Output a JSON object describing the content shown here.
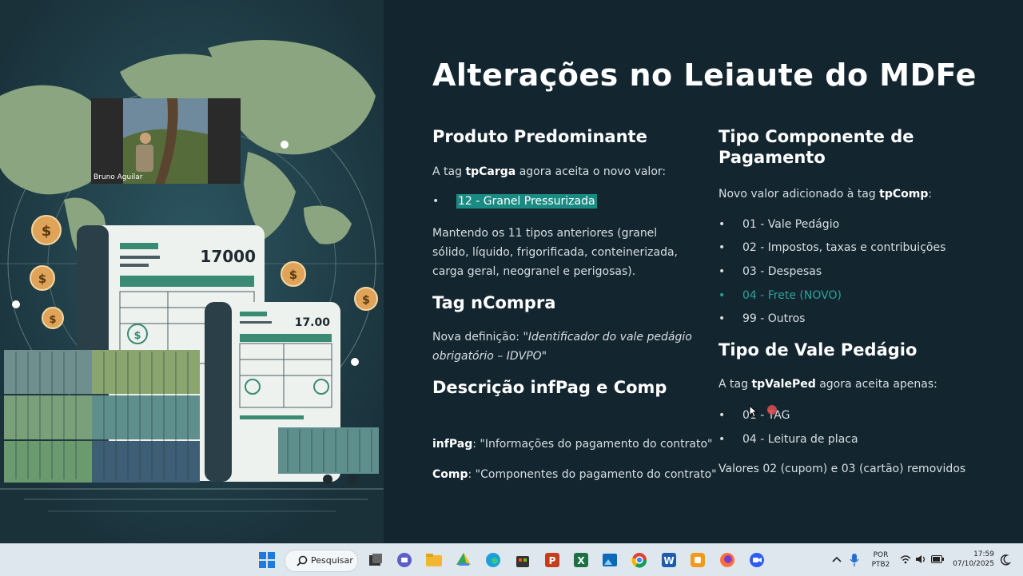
{
  "slide": {
    "title": "Alterações no Leiaute do MDFe",
    "webcam_name": "Bruno Aguilar",
    "left": {
      "s1_heading": "Produto Predominante",
      "s1_text_pre": "A tag ",
      "s1_text_tag": "tpCarga",
      "s1_text_post": " agora aceita o novo valor:",
      "s1_bullet": "12 - Granel Pressurizada",
      "s1_para": "Mantendo os 11 tipos anteriores (granel sólido, líquido, frigorificada, conteinerizada, carga geral, neogranel e perigosas).",
      "s2_heading": "Tag nCompra",
      "s2_text_pre": "Nova definição: ",
      "s2_text_quote": "\"Identificador do vale pedágio obrigatório – IDVPO\"",
      "s3_heading": "Descrição infPag e Comp",
      "s3_line1_tag": "infPag",
      "s3_line1_text": ": \"Informações do pagamento do contrato\"",
      "s3_line2_tag": "Comp",
      "s3_line2_text": ": \"Componentes do pagamento do contrato\""
    },
    "right": {
      "s1_heading_1": "Tipo Componente de",
      "s1_heading_2": "Pagamento",
      "s1_text_pre": "Novo valor adicionado à tag ",
      "s1_text_tag": "tpComp",
      "s1_text_post": ":",
      "s1_bullets": [
        "01 - Vale Pedágio",
        "02 - Impostos, taxas e contribuições",
        "03 - Despesas",
        "04 - Frete (NOVO)",
        "99 - Outros"
      ],
      "s2_heading": "Tipo de Vale Pedágio",
      "s2_text_pre": "A tag ",
      "s2_text_tag": "tpValePed",
      "s2_text_post": " agora aceita apenas:",
      "s2_bullets": [
        "01 - TAG",
        "04 - Leitura de placa"
      ],
      "s2_footer": "Valores 02 (cupom) e 03 (cartão) removidos"
    },
    "art": {
      "doc1_number": "17000",
      "doc2_number": "17.00"
    }
  },
  "taskbar": {
    "search_label": "Pesquisar",
    "lang_1": "POR",
    "lang_2": "PTB2",
    "time": "17:59",
    "date": "07/10/2025",
    "apps": [
      "windows-start",
      "task-view",
      "chat",
      "file-explorer",
      "google-drive",
      "edge",
      "store",
      "powerpoint",
      "excel",
      "photos",
      "chrome",
      "word",
      "app-orange",
      "firefox",
      "zoom"
    ]
  },
  "colors": {
    "background": "#13262f",
    "accent_teal": "#1a8b83",
    "text": "#d8dee2"
  }
}
